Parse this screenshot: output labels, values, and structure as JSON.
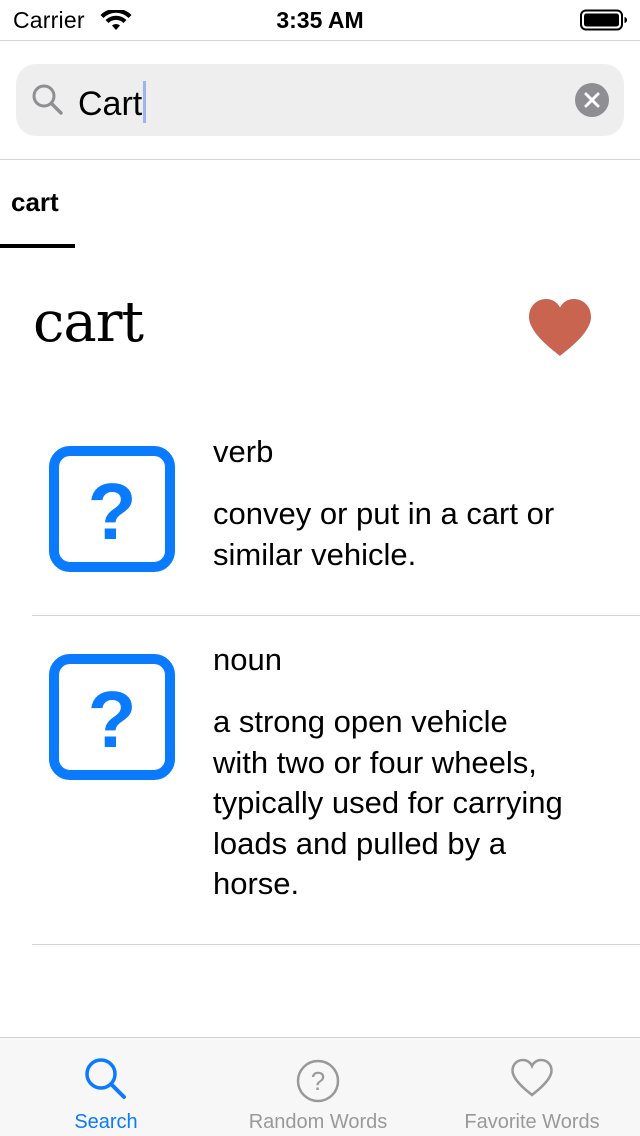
{
  "status_bar": {
    "carrier": "Carrier",
    "time": "3:35 AM"
  },
  "search": {
    "value": "Cart",
    "search_icon": "magnifying-glass-icon",
    "clear_icon": "clear-x-icon"
  },
  "result_tabs": [
    {
      "label": "cart",
      "selected": true
    }
  ],
  "entry": {
    "word": "cart",
    "favorite_icon": "heart-filled-icon",
    "favorite_color": "#c86450",
    "definitions": [
      {
        "icon": "question-mark-square-icon",
        "part_of_speech": "verb",
        "lines": [
          "convey or put in a cart or",
          "similar vehicle."
        ]
      },
      {
        "icon": "question-mark-square-icon",
        "part_of_speech": "noun",
        "lines": [
          "a strong open vehicle",
          "with two or four wheels,",
          "typically used for carrying",
          "loads and pulled by a",
          "horse."
        ]
      }
    ]
  },
  "tab_bar": {
    "active_color": "#0a7aff",
    "inactive_color": "#999999",
    "items": [
      {
        "label": "Search",
        "icon": "search-icon",
        "active": true
      },
      {
        "label": "Random Words",
        "icon": "question-circle-icon",
        "active": false
      },
      {
        "label": "Favorite Words",
        "icon": "heart-outline-icon",
        "active": false
      }
    ]
  },
  "colors": {
    "accent": "#0a7aff",
    "search_field_bg": "#eeeeef"
  }
}
